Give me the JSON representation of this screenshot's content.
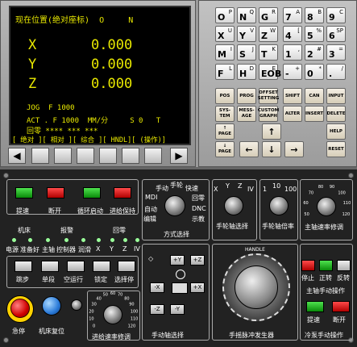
{
  "crt": {
    "header": "现在位置(绝对座标)  O     N",
    "axes": [
      {
        "name": "X",
        "value": "0.000"
      },
      {
        "name": "Y",
        "value": "0.000"
      },
      {
        "name": "Z",
        "value": "0.000"
      }
    ],
    "status1": "JOG  F 1000",
    "status2": "ACT . F 1000  MM/分     S 0   T",
    "status3": "回零 **** *** ***",
    "menu": "[ 绝对 ][ 相对 ][ 综合 ][ HNDL][ (操作)]"
  },
  "softkeys": {
    "left_arrow": "◀",
    "right_arrow": "▶"
  },
  "keypad": {
    "rows": [
      [
        {
          "m": "O",
          "s": "P"
        },
        {
          "m": "N",
          "s": "Q"
        },
        {
          "m": "G",
          "s": "R"
        },
        {
          "m": "7",
          "s": "A"
        },
        {
          "m": "8",
          "s": "B"
        },
        {
          "m": "9",
          "s": "C"
        }
      ],
      [
        {
          "m": "X",
          "s": "U"
        },
        {
          "m": "Y",
          "s": "V"
        },
        {
          "m": "Z",
          "s": "W"
        },
        {
          "m": "4",
          "s": "["
        },
        {
          "m": "5",
          "s": "%"
        },
        {
          "m": "6",
          "s": "SP"
        }
      ],
      [
        {
          "m": "M",
          "s": "I"
        },
        {
          "m": "S",
          "s": "J"
        },
        {
          "m": "T",
          "s": "K"
        },
        {
          "m": "1",
          "s": ","
        },
        {
          "m": "2",
          "s": "#"
        },
        {
          "m": "3",
          "s": "="
        }
      ],
      [
        {
          "m": "F",
          "s": "L"
        },
        {
          "m": "H",
          "s": "D"
        },
        {
          "m": "EOB",
          "s": "E"
        },
        {
          "m": "-",
          "s": "+"
        },
        {
          "m": "0",
          "s": "*"
        },
        {
          "m": ".",
          "s": "/"
        }
      ]
    ],
    "func_row1": [
      "POS",
      "PROG",
      "OFFSET SETTING",
      "SHIFT",
      "CAN",
      "INPUT"
    ],
    "func_row2": [
      "SYS-TEM",
      "MESS-AGE",
      "CUSTOM GRAPH",
      "ALTER",
      "INSERT",
      "DELETE"
    ],
    "pageup": "↑ PAGE",
    "pagedown": "↓ PAGE",
    "arrow_up": "↑",
    "arrow_left": "←",
    "arrow_down": "↓",
    "arrow_right": "→",
    "help": "HELP",
    "reset": "RESET"
  },
  "panel": {
    "btn_labels": [
      "提速",
      "断开",
      "循环启动",
      "进给保持"
    ],
    "group_machine": "机床",
    "group_alarm": "报警",
    "group_home": "回零",
    "led_labels": [
      "电源",
      "准备好",
      "主轴",
      "控制器",
      "润滑",
      "X",
      "Y",
      "Z",
      "IV"
    ],
    "mode_labels": [
      "手动",
      "手轮",
      "快速",
      "回零",
      "DNC",
      "示教",
      "编辑",
      "自动",
      "MDI"
    ],
    "mode_title": "方式选择",
    "axis_letters": [
      "X",
      "Y",
      "Z",
      "IV"
    ],
    "axis_title": "手轮轴选择",
    "mult_labels": [
      "1",
      "10",
      "100"
    ],
    "mult_title": "手轮轴倍率",
    "spindle_ticks": [
      "50",
      "60",
      "70",
      "80",
      "90",
      "100",
      "110",
      "120"
    ],
    "spindle_title": "主轴速率修调",
    "row2_labels": [
      "跳步",
      "单段",
      "空运行",
      "锁定",
      "选择停"
    ],
    "estop": "急停",
    "reset": "机床复位",
    "feed_ticks": [
      "0",
      "10",
      "20",
      "30",
      "40",
      "50",
      "60",
      "70",
      "80",
      "90",
      "100",
      "110",
      "120"
    ],
    "feed_title": "进给速率修调",
    "jog_buttons": [
      "+Y",
      "+Z",
      "-X",
      "+X",
      "-Z",
      "-Y"
    ],
    "jog_title": "手动轴选择",
    "handle_top": "HANDLE",
    "handle_title": "手摇脉冲发生器",
    "spindle_ctrl": [
      "停止",
      "正转",
      "反转"
    ],
    "spindle_ctrl_title": "主轴手动操作",
    "coolant": [
      "提速",
      "断开"
    ],
    "coolant_title": "冷泵手动操作"
  }
}
